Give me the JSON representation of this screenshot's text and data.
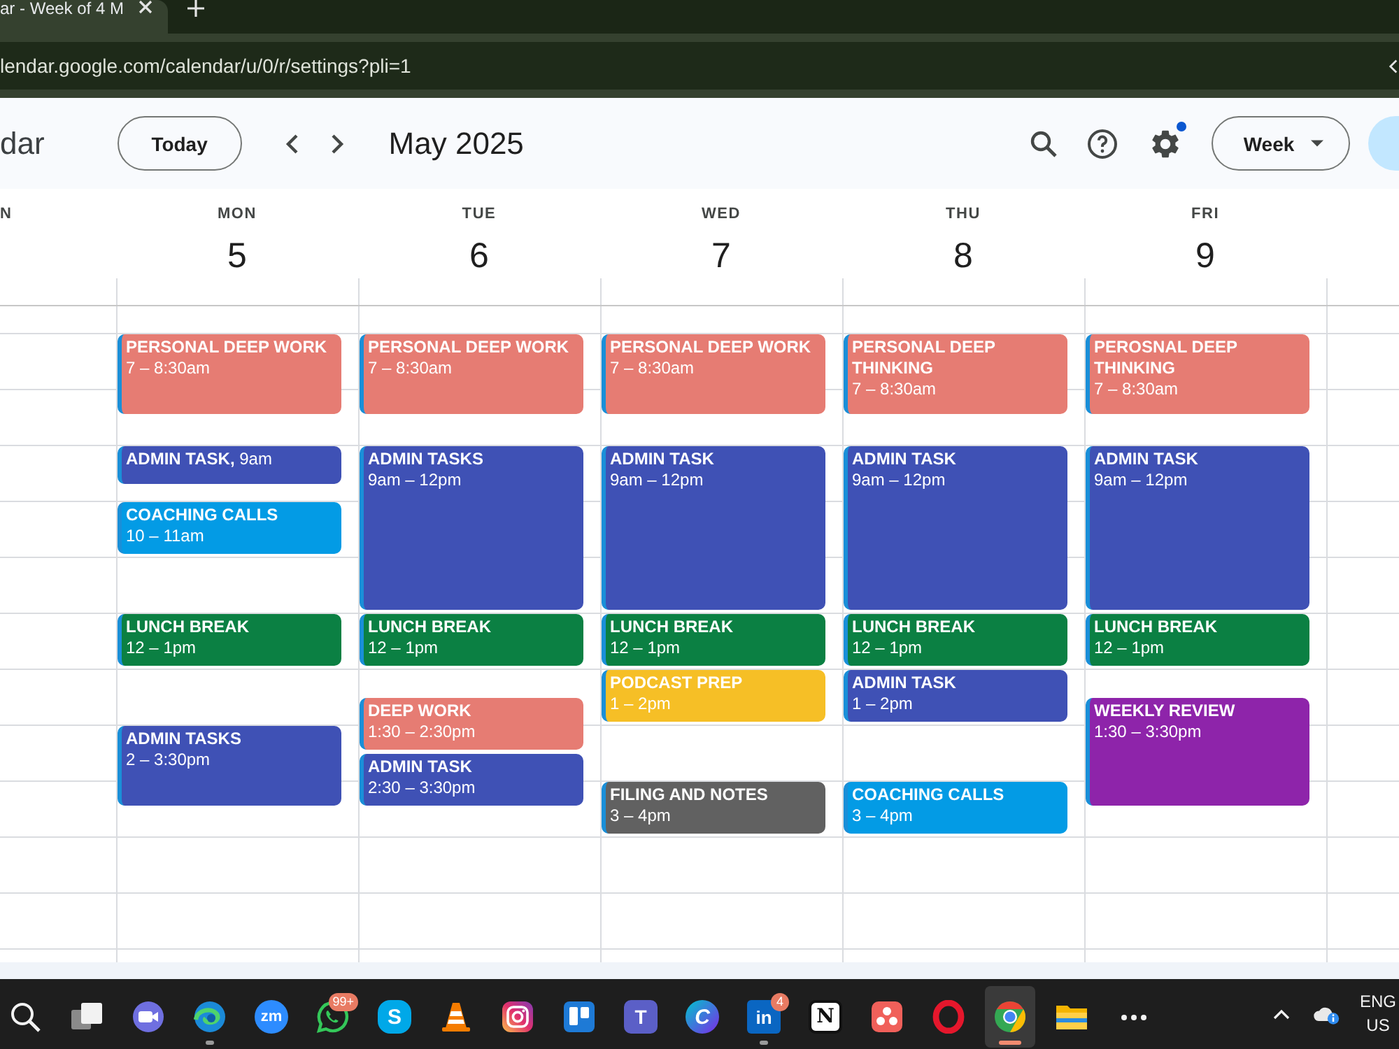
{
  "browser": {
    "tab_title": "ar - Week of 4 M",
    "url": "lendar.google.com/calendar/u/0/r/settings?pli=1"
  },
  "toolbar": {
    "app_name": "dar",
    "today": "Today",
    "month": "May 2025",
    "settings_notification": true,
    "view": "Week"
  },
  "days": [
    {
      "name": "N"
    },
    {
      "name": "MON",
      "number": "5",
      "events": [
        {
          "kind": "block",
          "title": "PERSONAL DEEP WORK",
          "time": "7 – 8:30am",
          "color": "#e67c73"
        },
        {
          "kind": "compact",
          "title": "ADMIN TASK,",
          "time": "9am",
          "color": "#3f51b5"
        },
        {
          "kind": "block",
          "title": "COACHING CALLS",
          "time": "10 – 11am",
          "color": "#039be5"
        },
        {
          "kind": "block",
          "title": "LUNCH BREAK",
          "time": "12 – 1pm",
          "color": "#0b8043"
        },
        {
          "kind": "block",
          "title": "ADMIN TASKS",
          "time": "2 – 3:30pm",
          "color": "#3f51b5"
        }
      ]
    },
    {
      "name": "TUE",
      "number": "6",
      "events": [
        {
          "kind": "block",
          "title": "PERSONAL DEEP WORK",
          "time": "7 – 8:30am",
          "color": "#e67c73"
        },
        {
          "kind": "block",
          "title": "ADMIN TASKS",
          "time": "9am – 12pm",
          "color": "#3f51b5"
        },
        {
          "kind": "block",
          "title": "LUNCH BREAK",
          "time": "12 – 1pm",
          "color": "#0b8043"
        },
        {
          "kind": "block",
          "title": "DEEP WORK",
          "time": "1:30 – 2:30pm",
          "color": "#e67c73"
        },
        {
          "kind": "block",
          "title": "ADMIN TASK",
          "time": "2:30 – 3:30pm",
          "color": "#3f51b5"
        }
      ]
    },
    {
      "name": "WED",
      "number": "7",
      "events": [
        {
          "kind": "block",
          "title": "PERSONAL DEEP WORK",
          "time": "7 – 8:30am",
          "color": "#e67c73"
        },
        {
          "kind": "block",
          "title": "ADMIN TASK",
          "time": "9am – 12pm",
          "color": "#3f51b5"
        },
        {
          "kind": "block",
          "title": "LUNCH BREAK",
          "time": "12 – 1pm",
          "color": "#0b8043"
        },
        {
          "kind": "block",
          "title": "PODCAST PREP",
          "time": "1 – 2pm",
          "color": "#f6bf26"
        },
        {
          "kind": "block",
          "title": "FILING AND NOTES",
          "time": "3 – 4pm",
          "color": "#616161"
        }
      ]
    },
    {
      "name": "THU",
      "number": "8",
      "events": [
        {
          "kind": "block",
          "title": "PERSONAL DEEP THINKING",
          "time": "7 – 8:30am",
          "color": "#e67c73"
        },
        {
          "kind": "block",
          "title": "ADMIN TASK",
          "time": "9am – 12pm",
          "color": "#3f51b5"
        },
        {
          "kind": "block",
          "title": "LUNCH BREAK",
          "time": "12 – 1pm",
          "color": "#0b8043"
        },
        {
          "kind": "block",
          "title": "ADMIN TASK",
          "time": "1 – 2pm",
          "color": "#3f51b5"
        },
        {
          "kind": "block",
          "title": "COACHING CALLS",
          "time": "3 – 4pm",
          "color": "#039be5"
        }
      ]
    },
    {
      "name": "FRI",
      "number": "9",
      "events": [
        {
          "kind": "block",
          "title": "PEROSNAL DEEP THINKING",
          "time": "7 – 8:30am",
          "color": "#e67c73"
        },
        {
          "kind": "block",
          "title": "ADMIN TASK",
          "time": "9am – 12pm",
          "color": "#3f51b5"
        },
        {
          "kind": "block",
          "title": "LUNCH BREAK",
          "time": "12 – 1pm",
          "color": "#0b8043"
        },
        {
          "kind": "block",
          "title": "WEEKLY REVIEW",
          "time": "1:30 – 3:30pm",
          "color": "#8e24aa"
        }
      ]
    }
  ],
  "taskbar": {
    "apps": [
      {
        "kind": "search",
        "running": false,
        "selected": false
      },
      {
        "kind": "task-view",
        "running": false,
        "selected": false
      },
      {
        "kind": "camera",
        "running": false,
        "selected": false
      },
      {
        "kind": "swirl",
        "running": true,
        "selected": false
      },
      {
        "kind": "meeting",
        "glyph": "zm",
        "running": false,
        "selected": false
      },
      {
        "kind": "chat",
        "badge": "99+",
        "running": false,
        "selected": false
      },
      {
        "kind": "call",
        "glyph": "S",
        "running": false,
        "selected": false
      },
      {
        "kind": "cone",
        "running": false,
        "selected": false
      },
      {
        "kind": "photo",
        "running": false,
        "selected": false
      },
      {
        "kind": "board",
        "running": false,
        "selected": false
      },
      {
        "kind": "team",
        "glyph": "T",
        "running": false,
        "selected": false
      },
      {
        "kind": "design",
        "glyph": "C",
        "running": false,
        "selected": false
      },
      {
        "kind": "network",
        "glyph": "in",
        "badge": "4",
        "running": true,
        "selected": false
      },
      {
        "kind": "notes",
        "glyph": "N",
        "running": false,
        "selected": false
      },
      {
        "kind": "dots",
        "running": false,
        "selected": false
      },
      {
        "kind": "ring",
        "running": false,
        "selected": false
      },
      {
        "kind": "browser",
        "running": true,
        "selected": true
      },
      {
        "kind": "folder",
        "running": false,
        "selected": false
      },
      {
        "kind": "more",
        "running": false,
        "selected": false
      }
    ],
    "language": "ENG",
    "region": "US"
  }
}
